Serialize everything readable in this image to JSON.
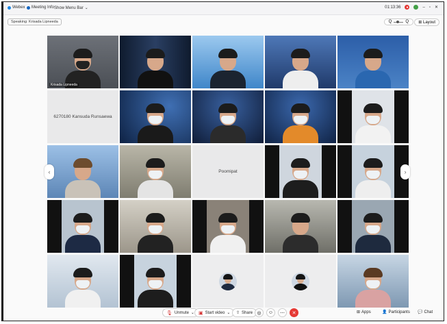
{
  "topbar": {
    "webex": "Webex",
    "meeting_info": "Meeting Info",
    "show_menu_bar": "Show Menu Bar",
    "timer": "01:13:36"
  },
  "speaking": {
    "label": "Speaking: Krisada Lipneeda"
  },
  "zoom": {
    "minus": "Q",
    "plus": "Q"
  },
  "layout_label": "Layout",
  "tiles": [
    {
      "label": "Krisada Lipneeda"
    },
    {
      "label": ""
    },
    {
      "label": ""
    },
    {
      "label": ""
    },
    {
      "label": ""
    },
    {
      "label": "6270180 Kansuda Runsaewa"
    },
    {
      "label": ""
    },
    {
      "label": ""
    },
    {
      "label": ""
    },
    {
      "label": ""
    },
    {
      "label": ""
    },
    {
      "label": ""
    },
    {
      "label": "Poomipat"
    },
    {
      "label": ""
    },
    {
      "label": ""
    }
  ],
  "controls": {
    "unmute": "Unmute",
    "start_video": "Start video",
    "share": "Share",
    "apps": "Apps",
    "participants": "Participants",
    "chat": "Chat"
  },
  "colors": {
    "accent": "#1e88e5",
    "leave": "#e53935",
    "mute_icon": "#d32f2f"
  }
}
